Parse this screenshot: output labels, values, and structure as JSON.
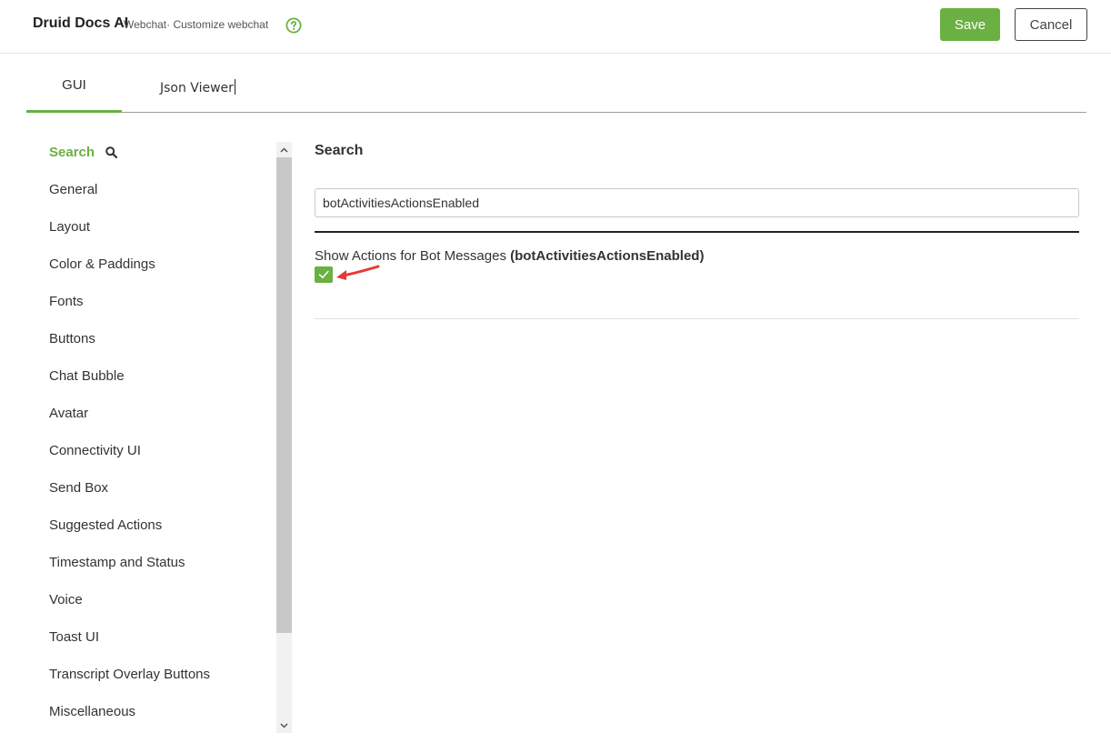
{
  "header": {
    "app_title": "Druid Docs AI",
    "breadcrumb": "Webchat· Customize webchat",
    "save_label": "Save",
    "cancel_label": "Cancel"
  },
  "tabs": [
    {
      "label": "GUI",
      "active": true
    },
    {
      "label": "Json Viewer",
      "active": false
    }
  ],
  "sidebar": {
    "items": [
      {
        "label": "Search",
        "active": true
      },
      {
        "label": "General"
      },
      {
        "label": "Layout"
      },
      {
        "label": "Color & Paddings"
      },
      {
        "label": "Fonts"
      },
      {
        "label": "Buttons"
      },
      {
        "label": "Chat Bubble"
      },
      {
        "label": "Avatar"
      },
      {
        "label": "Connectivity UI"
      },
      {
        "label": "Send Box"
      },
      {
        "label": "Suggested Actions"
      },
      {
        "label": "Timestamp and Status"
      },
      {
        "label": "Voice"
      },
      {
        "label": "Toast UI"
      },
      {
        "label": "Transcript Overlay Buttons"
      },
      {
        "label": "Miscellaneous"
      }
    ]
  },
  "main": {
    "title": "Search",
    "search_value": "botActivitiesActionsEnabled",
    "setting": {
      "label": "Show Actions for Bot Messages ",
      "key": "(botActivitiesActionsEnabled)",
      "checked": true
    }
  },
  "colors": {
    "accent": "#6bb042",
    "annotation_arrow": "#e53935"
  },
  "icons": {
    "help": "question-circle-icon",
    "search": "magnifier-icon",
    "check": "checkmark-icon"
  }
}
